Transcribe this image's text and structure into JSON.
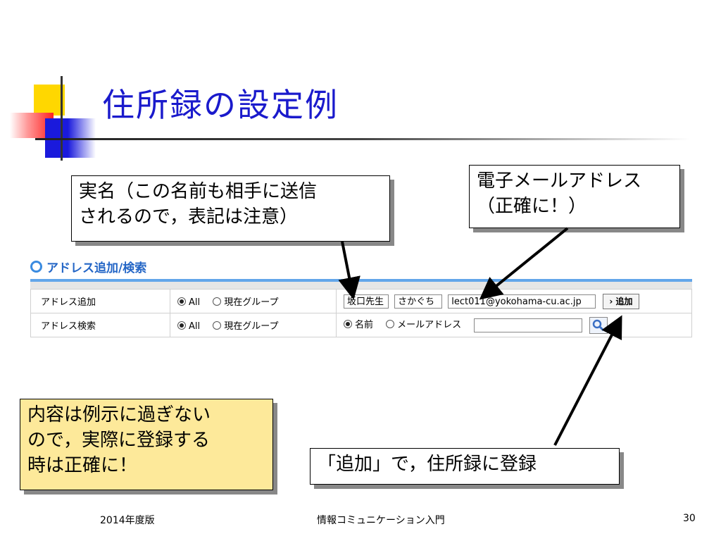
{
  "slide": {
    "title": "住所録の設定例",
    "callouts": {
      "name_line1": "実名（この名前も相手に送信",
      "name_line2": "されるので，表記は注意）",
      "email_line1": "電子メールアドレス",
      "email_line2": "（正確に！）",
      "note_line1": "内容は例示に過ぎない",
      "note_line2": "ので，実際に登録する",
      "note_line3": "時は正確に！",
      "add": "「追加」で，住所録に登録"
    }
  },
  "section": {
    "title": "アドレス追加/検索"
  },
  "table": {
    "add_row": {
      "label": "アドレス追加",
      "opt_all": "All",
      "opt_group": "現在グループ",
      "last_name": "坂口先生",
      "reading": "さかぐち",
      "email": "lect011@yokohama-cu.ac.jp",
      "add_button": "› 追加"
    },
    "search_row": {
      "label": "アドレス検索",
      "opt_all": "All",
      "opt_group": "現在グループ",
      "opt_name": "名前",
      "opt_mail": "メールアドレス",
      "query": ""
    }
  },
  "footer": {
    "edition": "2014年度版",
    "course": "情報コミュニケーション入門",
    "page": "30"
  },
  "colors": {
    "title": "#1a1acc",
    "section": "#2466c6",
    "note_bg": "#fde99a"
  }
}
